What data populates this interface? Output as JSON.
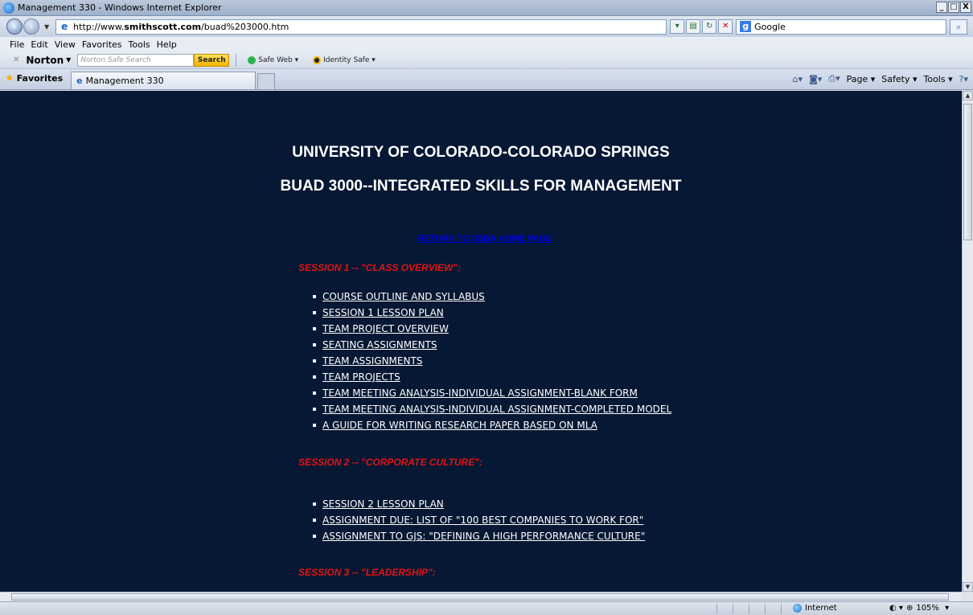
{
  "window": {
    "title": "Management 330 - Windows Internet Explorer",
    "controls": [
      "_",
      "□",
      "X"
    ]
  },
  "address_bar": {
    "url_prefix": "http://www.",
    "url_domain": "smithscott.com",
    "url_path": "/buad%203000.htm",
    "search_engine": "Google"
  },
  "menu": [
    "File",
    "Edit",
    "View",
    "Favorites",
    "Tools",
    "Help"
  ],
  "norton": {
    "brand": "Norton",
    "search_placeholder": "Norton Safe Search",
    "search_button": "Search",
    "safe_web": "Safe Web",
    "identity_safe": "Identity Safe"
  },
  "tabs": {
    "favorites_label": "Favorites",
    "active_tab": "Management 330"
  },
  "command_bar": {
    "page": "Page",
    "safety": "Safety",
    "tools": "Tools"
  },
  "content": {
    "heading1": "UNIVERSITY OF COLORADO-COLORADO SPRINGS",
    "heading2": "BUAD 3000--INTEGRATED SKILLS FOR MANAGEMENT",
    "return_link": "RETURN TO SSBA HOME PAGE",
    "sessions": [
      {
        "title": "SESSION 1 -- \"CLASS OVERVIEW\":",
        "links": [
          "COURSE OUTLINE AND SYLLABUS",
          "SESSION 1 LESSON PLAN",
          "TEAM PROJECT OVERVIEW",
          "SEATING ASSIGNMENTS",
          "TEAM ASSIGNMENTS",
          "TEAM PROJECTS",
          "TEAM MEETING ANALYSIS-INDIVIDUAL ASSIGNMENT-BLANK FORM",
          "TEAM MEETING ANALYSIS-INDIVIDUAL ASSIGNMENT-COMPLETED MODEL",
          "A GUIDE FOR WRITING RESEARCH PAPER BASED ON MLA"
        ]
      },
      {
        "title": "SESSION 2 -- \"CORPORATE CULTURE\":",
        "links": [
          "SESSION 2 LESSON PLAN",
          "ASSIGNMENT DUE:  LIST OF \"100 BEST COMPANIES TO WORK FOR\"",
          "ASSIGNMENT TO GJS:  \"DEFINING A HIGH PERFORMANCE CULTURE\""
        ]
      },
      {
        "title": "SESSION 3 -- \"LEADERSHIP\":",
        "links": []
      }
    ]
  },
  "status": {
    "zone": "Internet",
    "zoom": "105%"
  },
  "colors": {
    "page_background": "#061833",
    "session_title": "#e01414",
    "return_link": "#0000e8",
    "link_text": "#ffffff"
  }
}
